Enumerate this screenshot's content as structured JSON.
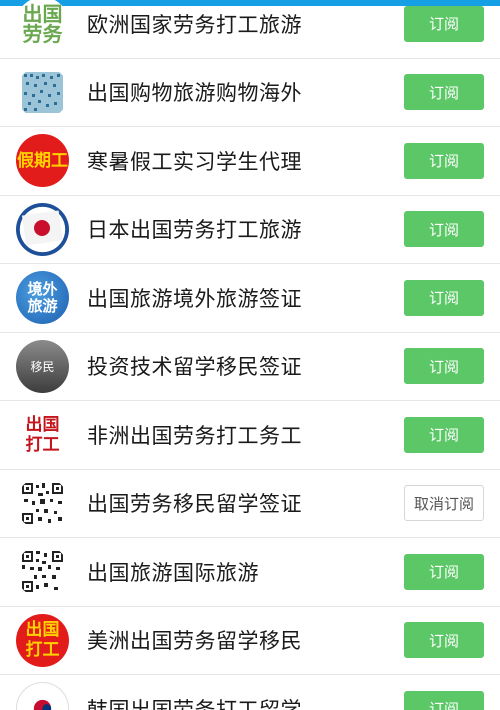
{
  "colors": {
    "accent_green": "#5cc766",
    "top_bar": "#15a0e6"
  },
  "subscribe_label": "订阅",
  "unsubscribe_label": "取消订阅",
  "items": [
    {
      "title": "欧洲国家劳务打工旅游",
      "avatar_text": "出国劳务",
      "subscribed": false
    },
    {
      "title": "出国购物旅游购物海外",
      "avatar_text": "",
      "subscribed": false
    },
    {
      "title": "寒暑假工实习学生代理",
      "avatar_text": "假期工",
      "subscribed": false
    },
    {
      "title": "日本出国劳务打工旅游",
      "avatar_text": "",
      "subscribed": false
    },
    {
      "title": "出国旅游境外旅游签证",
      "avatar_text": "境外旅游",
      "subscribed": false
    },
    {
      "title": "投资技术留学移民签证",
      "avatar_text": "移民",
      "subscribed": false
    },
    {
      "title": "非洲出国劳务打工务工",
      "avatar_text": "出国打工",
      "subscribed": false
    },
    {
      "title": "出国劳务移民留学签证",
      "avatar_text": "",
      "subscribed": true
    },
    {
      "title": "出国旅游国际旅游",
      "avatar_text": "",
      "subscribed": false
    },
    {
      "title": "美洲出国劳务留学移民",
      "avatar_text": "出国打工",
      "subscribed": false
    },
    {
      "title": "韩国出国劳务打工留学",
      "avatar_text": "",
      "subscribed": false
    }
  ]
}
